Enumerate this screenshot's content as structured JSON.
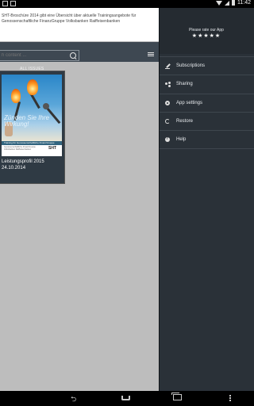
{
  "status_bar": {
    "time": "11:42"
  },
  "header": {
    "description": "SHT-Broschüre 2014 gibt eine Übersicht über aktuelle Trainingsangebote für Genossenschaftliche FinanzGruppe Volksbanken Raiffeisenbanken"
  },
  "search": {
    "placeholder": "h content ..."
  },
  "issues_label": "ALL ISSUES",
  "issues": [
    {
      "title": "Leistungsprofil 2015",
      "date": "24.10.2014",
      "cover": {
        "headline": "Zünden Sie Ihre Wirkung!",
        "band_text": "Training für Genossenschaftliche FinanzGruppe",
        "logo": "SHT",
        "subtext": "Genossenschaftliche FinanzGruppe Volksbanken Raiffeisenbanken"
      }
    }
  ],
  "drawer": {
    "rate_prompt": "Please rate our App",
    "stars": "★★★★★",
    "rating": 5,
    "items": [
      {
        "label": "Subscriptions",
        "icon": "edit-icon"
      },
      {
        "label": "Sharing",
        "icon": "share-icon"
      },
      {
        "label": "App settings",
        "icon": "gear-icon"
      },
      {
        "label": "Restore",
        "icon": "restore-icon"
      },
      {
        "label": "Help",
        "icon": "help-icon"
      }
    ]
  },
  "colors": {
    "header_bar": "#3e4852",
    "drawer_bg": "#2a3138",
    "content_bg": "#bdbdbd"
  }
}
